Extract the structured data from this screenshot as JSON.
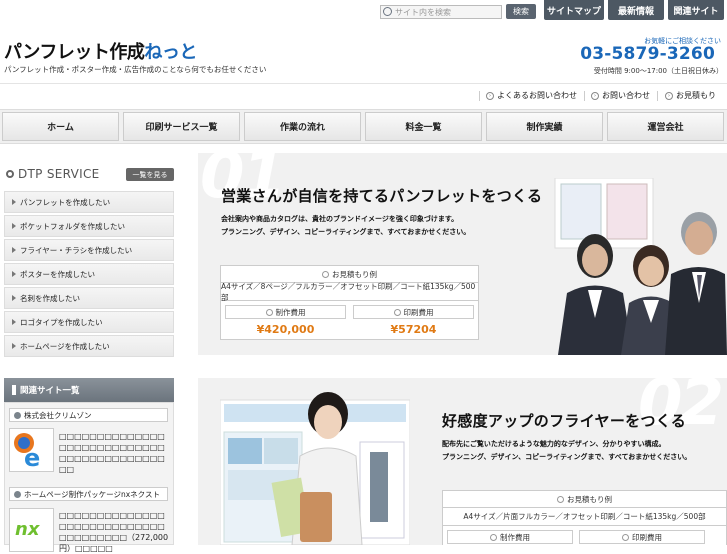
{
  "header": {
    "search_placeholder": "サイト内を検索",
    "search_button": "検索",
    "nav": [
      "サイトマップ",
      "最新情報",
      "関連サイト"
    ],
    "logo_main": "パンフレット作成",
    "logo_net": "ねっと",
    "tagline": "パンフレット作成・ポスター作成・広告作成のことなら何でもお任せください",
    "contact_label": "お気軽にご相談ください",
    "phone": "03-5879-3260",
    "hours": "受付時間 9:00～17:00（土日祝日休み）",
    "sublinks": [
      "よくあるお問い合わせ",
      "お問い合わせ",
      "お見積もり"
    ]
  },
  "main_nav": [
    "ホーム",
    "印刷サービス一覧",
    "作業の流れ",
    "料金一覧",
    "制作実績",
    "運営会社"
  ],
  "sidebar": {
    "dtp_title": "DTP SERVICE",
    "list_all": "一覧を見る",
    "items": [
      "パンフレットを作成したい",
      "ポケットフォルダを作成したい",
      "フライヤー・チラシを作成したい",
      "ポスターを作成したい",
      "名刺を作成したい",
      "ロゴタイプを作成したい",
      "ホームページを作成したい"
    ],
    "related_title": "関連サイト一覧",
    "related": [
      {
        "name": "株式会社クリムゾン",
        "text": "□□□□□□□□□□□□□□□□□□□□□□□□□□□□□□□□□□□□□□□□□□□□"
      },
      {
        "name": "ホームページ制作パッケージnxネクスト",
        "text": "□□□□□□□□□□□□□□□□□□□□□□□□□□□□□□□□□□□□□（272,000円）□□□□□"
      }
    ]
  },
  "banner1": {
    "num": "01",
    "title": "営業さんが自信を持てるパンフレットをつくる",
    "desc1": "会社案内や商品カタログは、貴社のブランドイメージを強く印象づけます。",
    "desc2": "プランニング、デザイン、コピーライティングまで、すべておまかせください。",
    "quote_title": "お見積もり例",
    "spec": "A4サイズ／8ページ／フルカラー／オフセット印刷／コート紙135kg／500部",
    "label_design": "制作費用",
    "label_print": "印刷費用",
    "price_design": "¥420,000",
    "price_print": "¥57204"
  },
  "banner2": {
    "num": "02",
    "title": "好感度アップのフライヤーをつくる",
    "desc1": "配布先にご覧いただけるような魅力的なデザイン、分かりやすい構成。",
    "desc2": "プランニング、デザイン、コピーライティングまで、すべておまかせください。",
    "quote_title": "お見積もり例",
    "spec": "A4サイズ／片面フルカラー／オフセット印刷／コート紙135kg／500部",
    "label_design": "制作費用",
    "label_print": "印刷費用"
  },
  "colors": {
    "brand_blue": "#1a67b8",
    "price_orange": "#e07a14",
    "nav_dark": "#4d5863"
  }
}
